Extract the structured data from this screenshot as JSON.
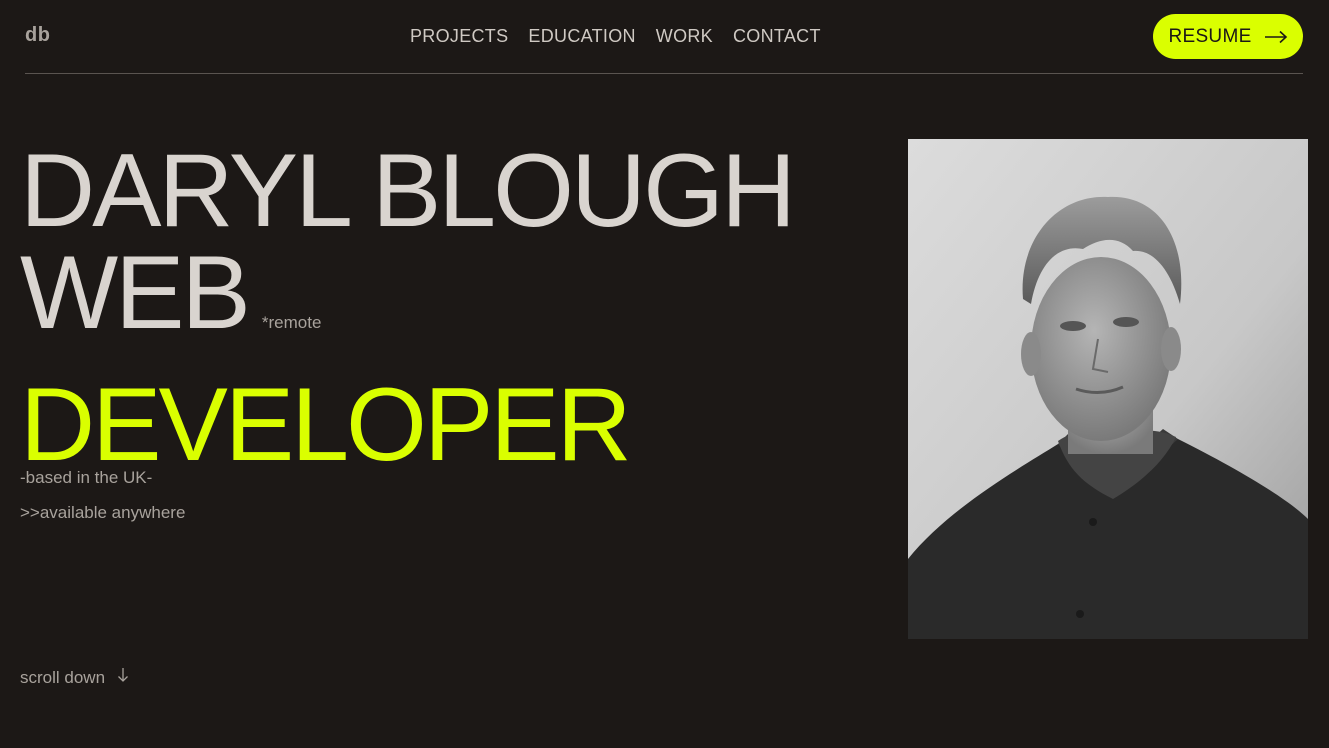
{
  "header": {
    "logo": "db",
    "nav": [
      {
        "label": "PROJECTS"
      },
      {
        "label": "EDUCATION"
      },
      {
        "label": "WORK"
      },
      {
        "label": "CONTACT"
      }
    ],
    "resume_label": "RESUME",
    "resume_icon": "arrow-right-icon"
  },
  "hero": {
    "name": "DARYL BLOUGH",
    "role_line1": "WEB",
    "remote_note": "*remote",
    "role_line2": "DEVELOPER",
    "location": "-based in the UK-",
    "availability": ">>available anywhere",
    "scroll_label": "scroll down",
    "scroll_icon": "arrow-down-icon"
  },
  "colors": {
    "background": "#1c1816",
    "accent": "#daff00",
    "text": "#d9d4cf",
    "muted": "#a8a29c"
  },
  "photo": {
    "icon": "portrait-photo"
  }
}
